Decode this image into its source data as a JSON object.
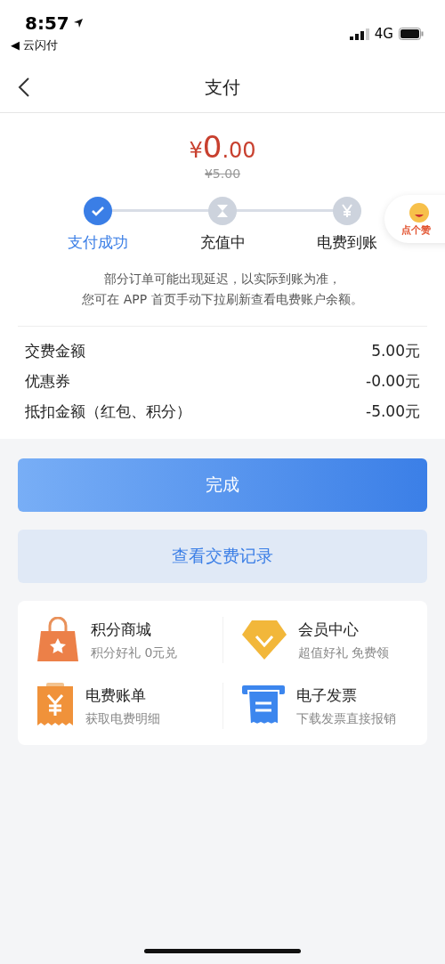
{
  "status_bar": {
    "time": "8:57",
    "back_app": "◀ 云闪付",
    "network": "4G"
  },
  "nav": {
    "title": "支付"
  },
  "amount": {
    "symbol": "¥",
    "whole": "0",
    "fraction": ".00",
    "original": "¥5.00"
  },
  "like_badge": {
    "label": "点个赞"
  },
  "steps": [
    {
      "label": "支付成功",
      "done": true,
      "kind": "check"
    },
    {
      "label": "充值中",
      "done": false,
      "kind": "hourglass"
    },
    {
      "label": "电费到账",
      "done": false,
      "kind": "yen"
    }
  ],
  "notice": [
    "部分订单可能出现延迟，以实际到账为准，",
    "您可在 APP 首页手动下拉刷新查看电费账户余额。"
  ],
  "details": [
    {
      "label": "交费金额",
      "value": "5.00元"
    },
    {
      "label": "优惠券",
      "value": "-0.00元"
    },
    {
      "label": "抵扣金额（红包、积分）",
      "value": "-5.00元"
    }
  ],
  "buttons": [
    {
      "label": "完成",
      "kind": "primary"
    },
    {
      "label": "查看交费记录",
      "kind": "secondary"
    }
  ],
  "services": [
    {
      "title": "积分商城",
      "subtitle": "积分好礼 0元兑",
      "kind": "bag"
    },
    {
      "title": "会员中心",
      "subtitle": "超值好礼 免费领",
      "kind": "diamond"
    },
    {
      "title": "电费账单",
      "subtitle": "获取电费明细",
      "kind": "receipt"
    },
    {
      "title": "电子发票",
      "subtitle": "下载发票直接报销",
      "kind": "invoice"
    }
  ]
}
